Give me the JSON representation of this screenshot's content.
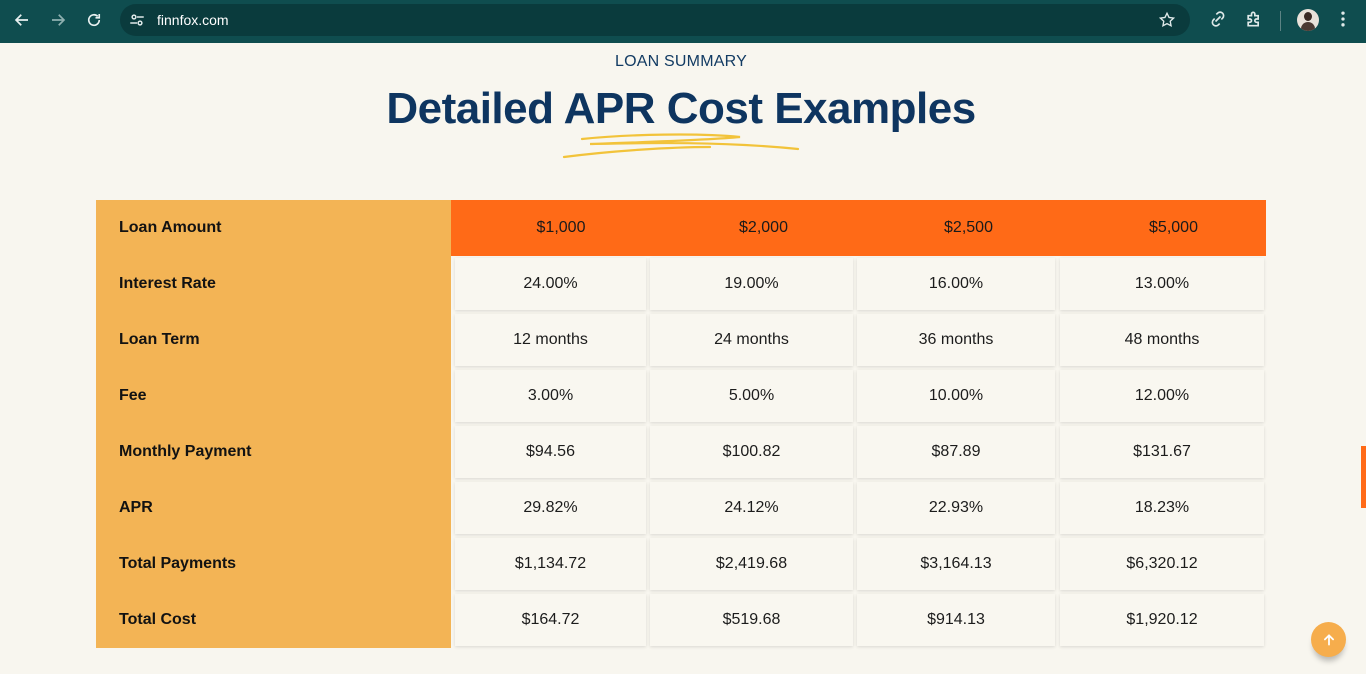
{
  "browser": {
    "url": "finnfox.com"
  },
  "page": {
    "eyebrow": "LOAN SUMMARY",
    "title": "Detailed APR Cost Examples"
  },
  "table": {
    "row_labels": [
      "Loan Amount",
      "Interest Rate",
      "Loan Term",
      "Fee",
      "Monthly Payment",
      "APR",
      "Total Payments",
      "Total Cost"
    ],
    "header": [
      "$1,000",
      "$2,000",
      "$2,500",
      "$5,000"
    ],
    "rows": [
      [
        "24.00%",
        "19.00%",
        "16.00%",
        "13.00%"
      ],
      [
        "12 months",
        "24 months",
        "36 months",
        "48 months"
      ],
      [
        "3.00%",
        "5.00%",
        "10.00%",
        "12.00%"
      ],
      [
        "$94.56",
        "$100.82",
        "$87.89",
        "$131.67"
      ],
      [
        "29.82%",
        "24.12%",
        "22.93%",
        "18.23%"
      ],
      [
        "$1,134.72",
        "$2,419.68",
        "$3,164.13",
        "$6,320.12"
      ],
      [
        "$164.72",
        "$519.68",
        "$914.13",
        "$1,920.12"
      ]
    ]
  },
  "colors": {
    "label_column": "#f3b455",
    "header_row": "#ff6a17",
    "title": "#0e3560",
    "browser_bar": "#0f4d4f"
  },
  "icons": [
    "back-icon",
    "forward-icon",
    "reload-icon",
    "site-settings-icon",
    "bookmark-star-icon",
    "link-icon",
    "extensions-icon",
    "profile-avatar",
    "menu-icon",
    "arrow-up-icon"
  ]
}
